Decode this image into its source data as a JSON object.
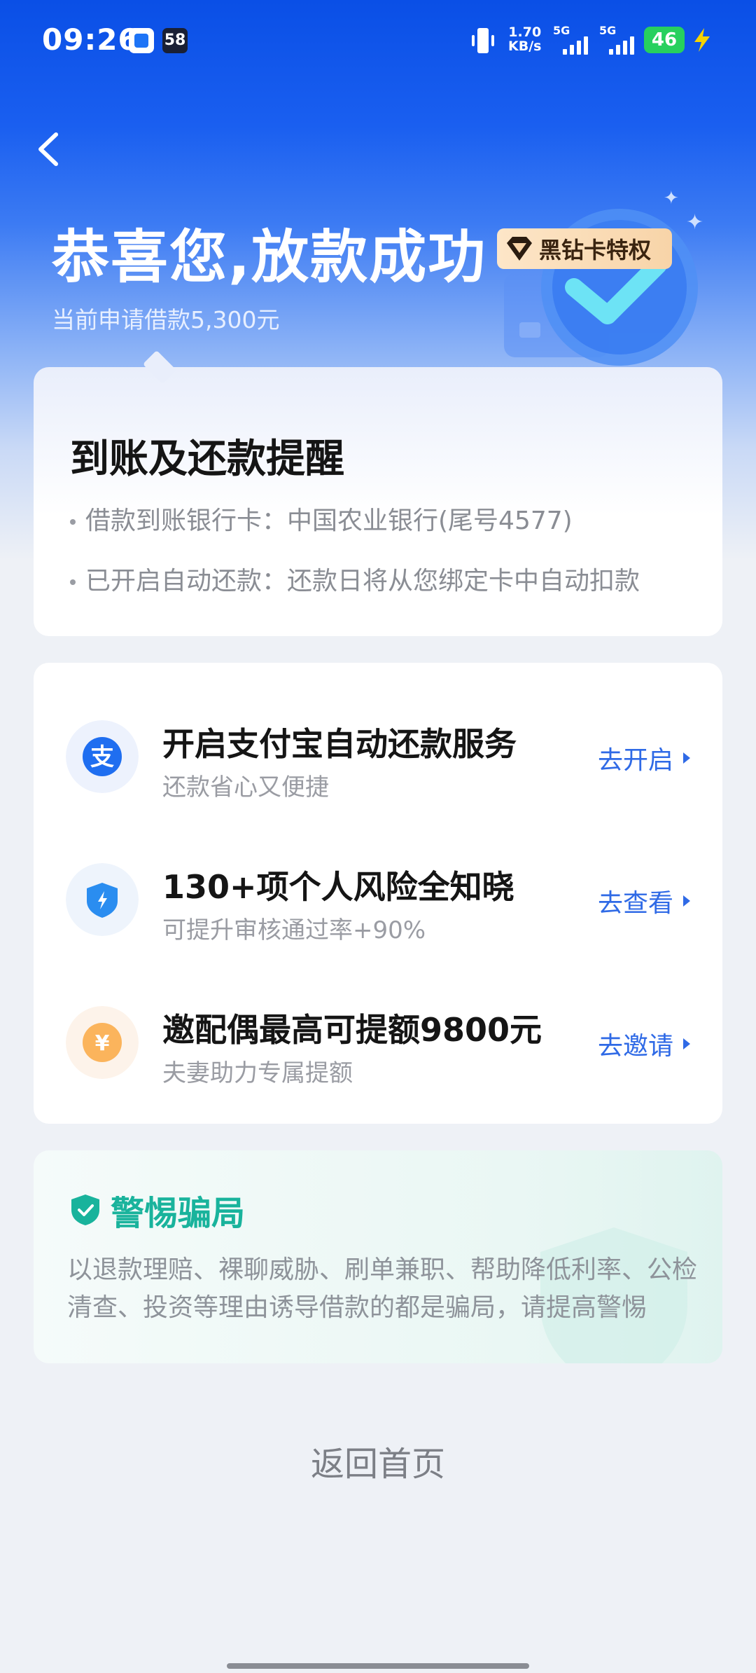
{
  "status_bar": {
    "time": "09:26",
    "app_badge": "58",
    "speed_value": "1.70",
    "speed_unit": "KB/s",
    "signal1_label": "5G",
    "signal2_label": "5G",
    "battery": "46"
  },
  "header": {
    "title": "恭喜您,放款成功",
    "subtitle": "当前申请借款5,300元",
    "badge": "黑钻卡特权"
  },
  "reminder": {
    "title": "到账及还款提醒",
    "lines": [
      "借款到账银行卡：中国农业银行(尾号4577)",
      "已开启自动还款：还款日将从您绑定卡中自动扣款"
    ]
  },
  "services": [
    {
      "title": "开启支付宝自动还款服务",
      "subtitle": "还款省心又便捷",
      "action": "去开启",
      "icon": "alipay-icon",
      "icon_glyph": "支"
    },
    {
      "title": "130+项个人风险全知晓",
      "subtitle": "可提升审核通过率+90%",
      "action": "去查看",
      "icon": "shield-bolt-icon"
    },
    {
      "title": "邀配偶最高可提额9800元",
      "subtitle": "夫妻助力专属提额",
      "action": "去邀请",
      "icon": "yen-coin-icon",
      "icon_glyph": "¥"
    }
  ],
  "warning": {
    "title": "警惕骗局",
    "text": "以退款理赔、裸聊威胁、刷单兼职、帮助降低利率、公检清查、投资等理由诱导借款的都是骗局，请提高警惕"
  },
  "footer": {
    "back_home": "返回首页"
  },
  "colors": {
    "brand_blue": "#0a4fe6",
    "action_blue": "#2f6ae6",
    "warning_green": "#19b39c"
  }
}
